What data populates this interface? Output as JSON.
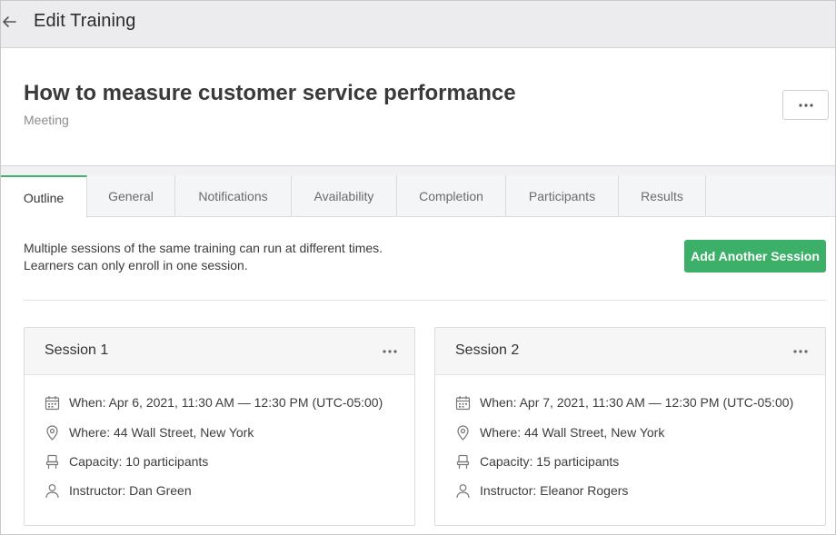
{
  "topbar": {
    "title": "Edit Training"
  },
  "header": {
    "title": "How to measure customer service performance",
    "type": "Meeting"
  },
  "tabs": [
    {
      "label": "Outline",
      "active": true
    },
    {
      "label": "General"
    },
    {
      "label": "Notifications"
    },
    {
      "label": "Availability"
    },
    {
      "label": "Completion"
    },
    {
      "label": "Participants"
    },
    {
      "label": "Results"
    }
  ],
  "info": {
    "line1": "Multiple sessions of the same training can run at different times.",
    "line2": "Learners can only enroll in one session."
  },
  "add_session_label": "Add Another Session",
  "sessions": [
    {
      "title": "Session 1",
      "when": "When: Apr 6, 2021, 11:30 AM — 12:30 PM (UTC-05:00)",
      "where": "Where: 44 Wall Street, New York",
      "capacity": "Capacity: 10 participants",
      "instructor": "Instructor: Dan Green"
    },
    {
      "title": "Session 2",
      "when": "When: Apr 7, 2021, 11:30 AM — 12:30 PM (UTC-05:00)",
      "where": "Where: 44 Wall Street, New York",
      "capacity": "Capacity: 15 participants",
      "instructor": "Instructor: Eleanor Rogers"
    }
  ],
  "colors": {
    "accent": "#3caf69",
    "tab_bg": "#f3f5f7",
    "topbar_bg": "#ececef"
  }
}
